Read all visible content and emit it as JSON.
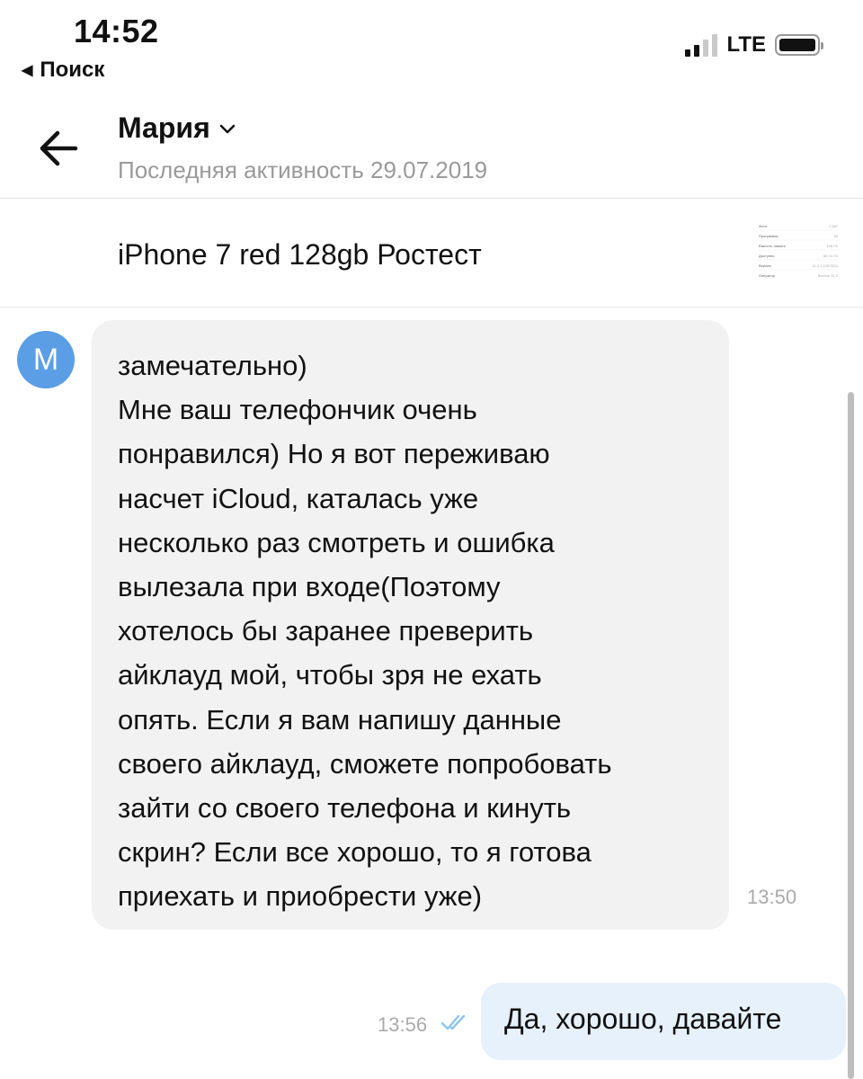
{
  "status_bar": {
    "time": "14:52",
    "back_label": "Поиск",
    "network": "LTE",
    "signal_bars_active": 2,
    "signal_bars_total": 4
  },
  "header": {
    "contact_name": "Мария",
    "last_seen": "Последняя активность 29.07.2019"
  },
  "product": {
    "title": "iPhone 7 red 128gb Ростест",
    "thumbnail_rows": [
      {
        "label": "Фото",
        "value": "1 687"
      },
      {
        "label": "Программы",
        "value": "59"
      },
      {
        "label": "Ёмкость памяти",
        "value": "128 ГБ"
      },
      {
        "label": "Доступно",
        "value": "69,74 ГБ"
      },
      {
        "label": "Версия",
        "value": "11.3.1 (15E302)"
      },
      {
        "label": "Оператор",
        "value": "Beeline 31.0"
      }
    ]
  },
  "messages": [
    {
      "direction": "incoming",
      "avatar_letter": "М",
      "text": "замечательно)\nМне ваш телефончик очень\nпонравился) Но я вот переживаю\nнасчет iCloud, каталась уже\nнесколько раз смотреть и ошибка\nвылезала при входе(Поэтому\nхотелось бы заранее преверить\nайклауд мой, чтобы зря не ехать\nопять. Если я вам напишу данные\nсвоего айклауд, сможете попробовать\nзайти со своего телефона и кинуть\nскрин? Если все хорошо, то я готова\nприехать и приобрести уже)",
      "time": "13:50"
    },
    {
      "direction": "outgoing",
      "text": "Да, хорошо, давайте",
      "time": "13:56",
      "read": true
    }
  ],
  "colors": {
    "avatar": "#5b9ee6",
    "incoming_bubble": "#f2f2f2",
    "outgoing_bubble": "#e6f1fb",
    "read_checks": "#8fc3ee"
  }
}
